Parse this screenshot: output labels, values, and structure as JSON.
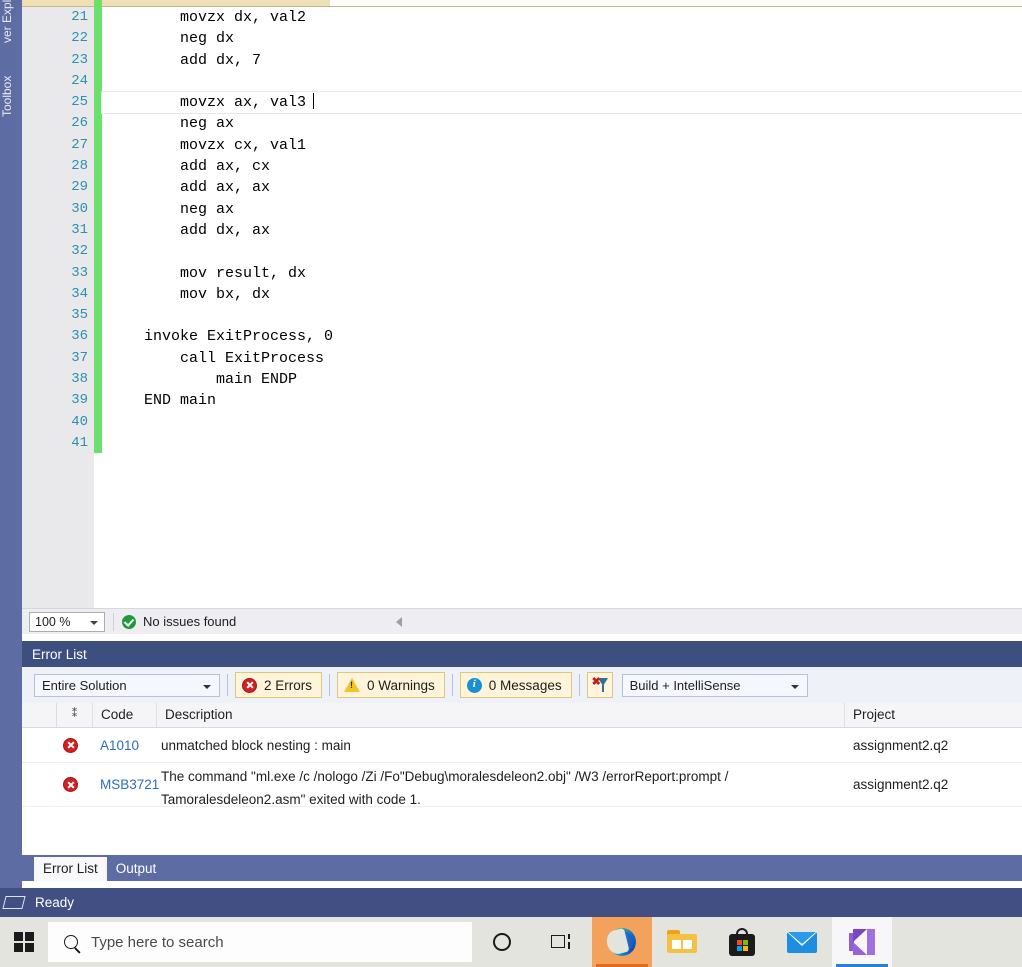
{
  "app": {
    "name": "Microsoft Visual Studio"
  },
  "dock_left": {
    "tabs": [
      {
        "label": "ver Explorer",
        "name": "server-explorer"
      },
      {
        "label": "Toolbox",
        "name": "toolbox"
      }
    ]
  },
  "editor": {
    "language": "masm-assembly",
    "current_line": 25,
    "first_visible_line": 21,
    "lines": [
      {
        "no": "21",
        "text": "    movzx dx, val2"
      },
      {
        "no": "22",
        "text": "    neg dx"
      },
      {
        "no": "23",
        "text": "    add dx, 7"
      },
      {
        "no": "24",
        "text": ""
      },
      {
        "no": "25",
        "text": "    movzx ax, val3"
      },
      {
        "no": "26",
        "text": "    neg ax"
      },
      {
        "no": "27",
        "text": "    movzx cx, val1"
      },
      {
        "no": "28",
        "text": "    add ax, cx"
      },
      {
        "no": "29",
        "text": "    add ax, ax"
      },
      {
        "no": "30",
        "text": "    neg ax"
      },
      {
        "no": "31",
        "text": "    add dx, ax"
      },
      {
        "no": "32",
        "text": ""
      },
      {
        "no": "33",
        "text": "    mov result, dx"
      },
      {
        "no": "34",
        "text": "    mov bx, dx"
      },
      {
        "no": "35",
        "text": ""
      },
      {
        "no": "36",
        "text": "invoke ExitProcess, 0"
      },
      {
        "no": "37",
        "text": "    call ExitProcess"
      },
      {
        "no": "38",
        "text": "        main ENDP"
      },
      {
        "no": "39",
        "text": "END main"
      },
      {
        "no": "40",
        "text": ""
      },
      {
        "no": "41",
        "text": ""
      }
    ]
  },
  "editor_status": {
    "zoom_value": "100 %",
    "issues_text": "No issues found",
    "issues_icon": "check-circle-icon",
    "nav_icon": "left-triangle-icon"
  },
  "error_list": {
    "title": "Error List",
    "scope_selected": "Entire Solution",
    "errors_label": "2 Errors",
    "warnings_label": "0 Warnings",
    "messages_label": "0 Messages",
    "filter_icon": "clear-filter-icon",
    "build_selected": "Build + IntelliSense",
    "columns": [
      "",
      "",
      "Code",
      "Description",
      "Project"
    ],
    "rows": [
      {
        "severity": "error",
        "code": "A1010",
        "description": "unmatched block nesting : main",
        "project": "assignment2.q2"
      },
      {
        "severity": "error",
        "code": "MSB3721",
        "description": "The command \"ml.exe /c /nologo /Zi /Fo\"Debug\\moralesdeleon2.obj\" /W3 /errorReport:prompt  /Tamoralesdeleon2.asm\" exited with code 1.",
        "description_line1": "The command \"ml.exe /c /nologo /Zi /Fo\"Debug\\moralesdeleon2.obj\" /W3 /errorReport:prompt  /",
        "description_line2": "Tamoralesdeleon2.asm\" exited with code 1.",
        "project": "assignment2.q2"
      }
    ]
  },
  "panel_tabs": [
    {
      "label": "Error List",
      "active": true
    },
    {
      "label": "Output",
      "active": false
    }
  ],
  "vs_status_bar": {
    "text": "Ready",
    "icon": "source-control-icon"
  },
  "taskbar": {
    "start_icon": "windows-logo-icon",
    "search_placeholder": "Type here to search",
    "cortana_icon": "cortana-ring-icon",
    "taskview_icon": "task-view-icon",
    "apps": [
      {
        "name": "microsoft-edge",
        "active": true
      },
      {
        "name": "file-explorer",
        "active": false
      },
      {
        "name": "microsoft-store",
        "active": false
      },
      {
        "name": "mail",
        "active": false
      },
      {
        "name": "visual-studio",
        "active": true
      }
    ]
  },
  "colors": {
    "vs_accent": "#414f83",
    "dock": "#5d6ca3",
    "panel_header": "#3d4f7f",
    "changebar_green": "#6ddf6d",
    "linenumber": "#2b91af",
    "code_link": "#2b6fb8",
    "error_red": "#d32020",
    "warn_yellow": "#f2c42a",
    "info_blue": "#1b8fd4",
    "counter_bg": "#fdf4d9"
  }
}
